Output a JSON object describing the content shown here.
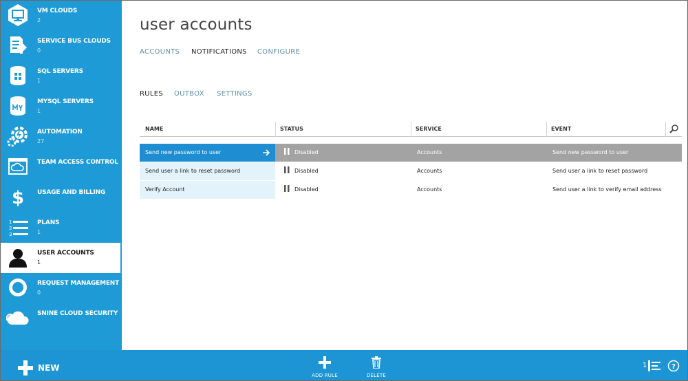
{
  "sidebar": {
    "items": [
      {
        "label": "VM CLOUDS",
        "count": "2",
        "icon": "monitor-icon"
      },
      {
        "label": "SERVICE BUS CLOUDS",
        "count": "0",
        "icon": "service-bus-icon"
      },
      {
        "label": "SQL SERVERS",
        "count": "1",
        "icon": "sql-database-icon"
      },
      {
        "label": "MYSQL SERVERS",
        "count": "1",
        "icon": "mysql-database-icon"
      },
      {
        "label": "AUTOMATION",
        "count": "27",
        "icon": "automation-gear-icon"
      },
      {
        "label": "TEAM ACCESS CONTROL",
        "count": "",
        "icon": "team-access-cloud-icon"
      },
      {
        "label": "USAGE AND BILLING",
        "count": "",
        "icon": "dollar-icon"
      },
      {
        "label": "PLANS",
        "count": "1",
        "icon": "numbered-list-icon"
      },
      {
        "label": "USER ACCOUNTS",
        "count": "1",
        "icon": "user-icon"
      },
      {
        "label": "REQUEST MANAGEMENT",
        "count": "0",
        "icon": "refresh-cycle-icon"
      },
      {
        "label": "SNINE CLOUD SECURITY",
        "count": "",
        "icon": "cloud-icon"
      }
    ],
    "active_index": 8
  },
  "main": {
    "title": "user accounts",
    "tabs": [
      {
        "label": "ACCOUNTS",
        "active": false
      },
      {
        "label": "NOTIFICATIONS",
        "active": true
      },
      {
        "label": "CONFIGURE",
        "active": false
      }
    ],
    "subtabs": [
      {
        "label": "RULES",
        "active": true
      },
      {
        "label": "OUTBOX",
        "active": false
      },
      {
        "label": "SETTINGS",
        "active": false
      }
    ]
  },
  "grid": {
    "columns": [
      "NAME",
      "STATUS",
      "SERVICE",
      "EVENT"
    ],
    "search_icon": "search-icon",
    "rows": [
      {
        "name": "Send new password to user",
        "status": "Disabled",
        "service": "Accounts",
        "event": "Send new password to user",
        "selected": true
      },
      {
        "name": "Send user a link to reset password",
        "status": "Disabled",
        "service": "Accounts",
        "event": "Send user a link to reset password",
        "selected": false
      },
      {
        "name": "Verify Account",
        "status": "Disabled",
        "service": "Accounts",
        "event": "Send user a link to verify email address",
        "selected": false
      }
    ]
  },
  "bottom_bar": {
    "new_label": "NEW",
    "add_rule_label": "ADD RULE",
    "delete_label": "DELETE",
    "activity_count": "1",
    "help_icon": "help-icon"
  },
  "colors": {
    "sidebar_bg": "#1e9ad6",
    "bottom_bar_bg": "#1d95d4",
    "selected_row": "#1e8dd2",
    "selected_row_rest": "#a3a3a3",
    "name_cell_bg": "#e3f3fb"
  }
}
